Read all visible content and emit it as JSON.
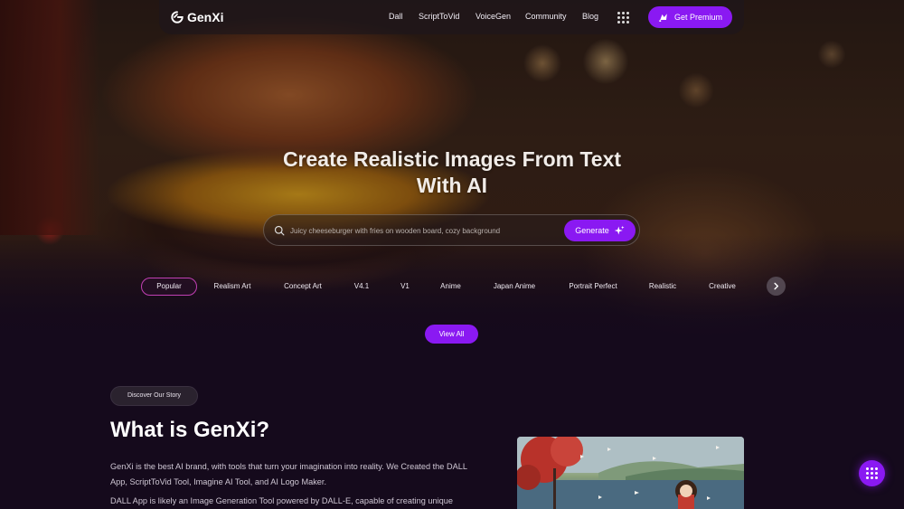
{
  "brand": {
    "name": "GenXi",
    "logo_icon": "genxi-logo-icon"
  },
  "nav": {
    "links": [
      "Dall",
      "ScriptToVid",
      "VoiceGen",
      "Community",
      "Blog"
    ],
    "apps_icon": "grid-dots-icon",
    "premium_label": "Get Premium",
    "premium_icon": "crown-rocket-icon"
  },
  "hero": {
    "headline_line1": "Create Realistic Images From Text",
    "headline_line2": "With AI"
  },
  "search": {
    "placeholder": "Juicy cheeseburger with fries on wooden board, cozy background",
    "value": "",
    "icon": "search-icon",
    "generate_label": "Generate",
    "generate_icon": "sparkle-icon"
  },
  "categories": {
    "items": [
      "Popular",
      "Realism Art",
      "Concept Art",
      "V4.1",
      "V1",
      "Anime",
      "Japan Anime",
      "Portrait Perfect",
      "Realistic",
      "Creative"
    ],
    "active": "Popular",
    "next_icon": "chevron-right-icon"
  },
  "view_all_label": "View All",
  "about": {
    "pill": "Discover Our Story",
    "title": "What is GenXi?",
    "paragraph1": "GenXi is the best AI brand, with tools that turn your imagination into reality. We Created the DALL App, ScriptToVid Tool, Imagine AI Tool, and AI Logo Maker.",
    "paragraph2": "DALL App is likely an Image Generation Tool powered by DALL-E, capable of creating unique"
  },
  "fab_icon": "menu-dots-icon",
  "colors": {
    "accent": "#8a19f2",
    "background": "#150a1c",
    "active_border": "#c03fb3"
  }
}
